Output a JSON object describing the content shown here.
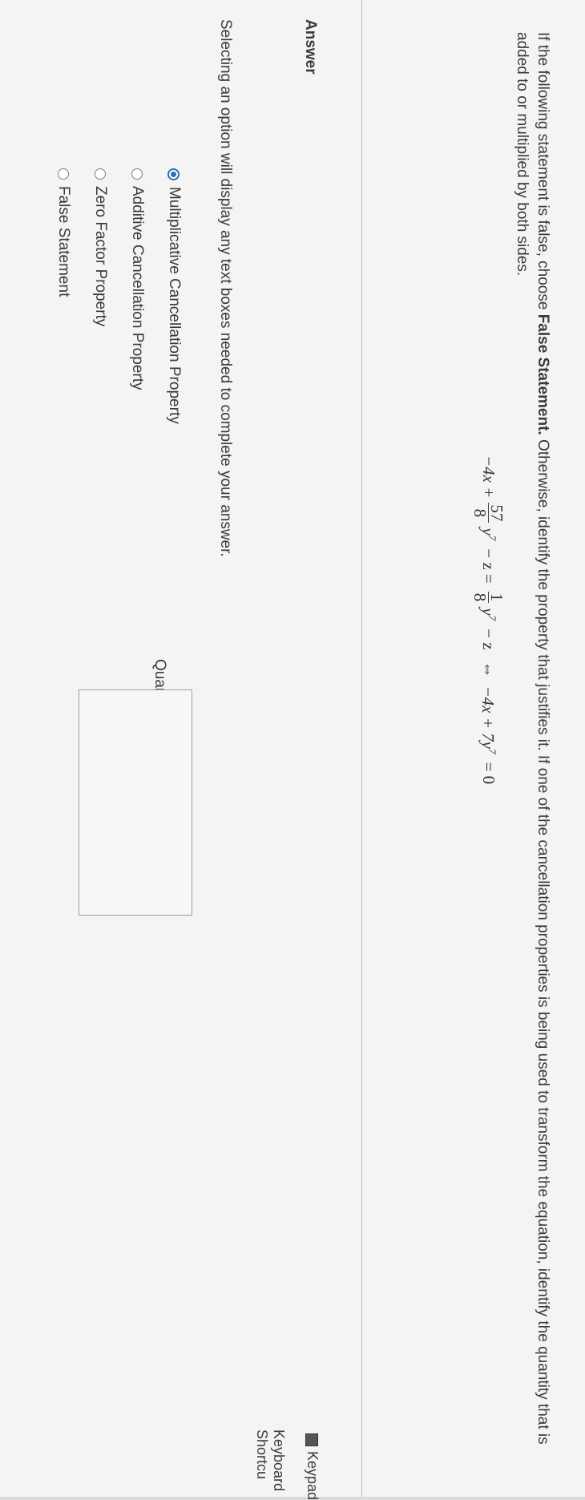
{
  "question": {
    "text_before": "If the following statement is false, choose ",
    "emphasis": "False Statement.",
    "text_after": " Otherwise, identify the property that justifies it. If one of the cancellation properties is being used to transform the equation, identify the quantity that is added to or multiplied by both sides."
  },
  "equation": {
    "lhs_start": "−4x +",
    "frac1_num": "57",
    "frac1_den": "8",
    "lhs_end": "y",
    "exp1": "7",
    "minus_z": "− z =",
    "frac2_num": "1",
    "frac2_den": "8",
    "y2": "y",
    "exp2": "7",
    "minus_z2": "− z",
    "iff": "⇔",
    "rhs": "−4x + 7y",
    "exp3": "7",
    "rhs_end": "= 0"
  },
  "answer": {
    "label": "Answer",
    "keypad": "Keypad",
    "keyboard_shortcuts": "Keyboard Shortcu",
    "instructions": "Selecting an option will display any text boxes needed to complete your answer.",
    "options": [
      {
        "label": "Multiplicative Cancellation Property",
        "selected": true
      },
      {
        "label": "Additive Cancellation Property",
        "selected": false
      },
      {
        "label": "Zero Factor Property",
        "selected": false
      },
      {
        "label": "False Statement",
        "selected": false
      }
    ],
    "quantity_label": "Quantity:",
    "quantity_value": ""
  },
  "colors": {
    "accent": "#2a6fb7",
    "text": "#3a3a3a",
    "background": "#f4f4f2"
  },
  "icons": [
    "keypad-icon",
    "radio-selected-icon",
    "radio-empty-icon"
  ]
}
